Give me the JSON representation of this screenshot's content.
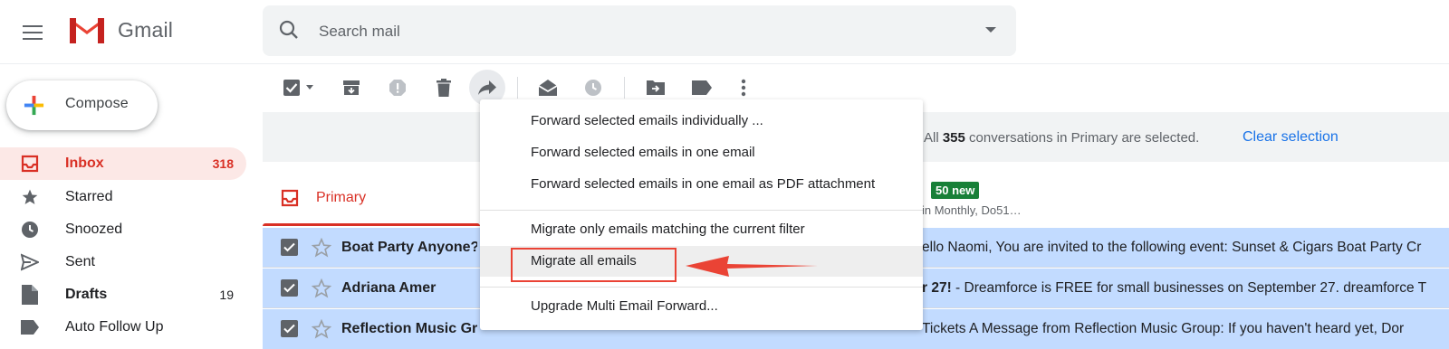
{
  "app": {
    "logo_text": "Gmail"
  },
  "search": {
    "placeholder": "Search mail"
  },
  "compose": {
    "label": "Compose"
  },
  "sidebar": {
    "items": [
      {
        "label": "Inbox",
        "count": "318",
        "icon": "inbox-icon",
        "active": true
      },
      {
        "label": "Starred",
        "count": "",
        "icon": "star-icon"
      },
      {
        "label": "Snoozed",
        "count": "",
        "icon": "clock-icon"
      },
      {
        "label": "Sent",
        "count": "",
        "icon": "send-icon"
      },
      {
        "label": "Drafts",
        "count": "19",
        "icon": "draft-icon"
      },
      {
        "label": "Auto Follow Up",
        "count": "",
        "icon": "label-icon"
      }
    ]
  },
  "toolbar": {
    "icons": [
      "select-all-checkbox",
      "archive-icon",
      "report-spam-icon",
      "delete-icon",
      "forward-icon",
      "mark-read-icon",
      "snooze-icon",
      "move-to-icon",
      "label-icon",
      "more-icon"
    ]
  },
  "banner": {
    "prefix": "All",
    "count": "355",
    "suffix": "conversations in Primary are selected.",
    "clear_label": "Clear selection"
  },
  "tabs": {
    "primary_label": "Primary",
    "new_badge": "50 new",
    "sub_text": "in Monthly, Do51…"
  },
  "emails": [
    {
      "sender": "Boat Party Anyone?",
      "subject": "",
      "snippet": "ello Naomi, You are invited to the following event: Sunset & Cigars Boat Party Cr"
    },
    {
      "sender": "Adriana Amer",
      "subject": "r 27!",
      "snippet": " - Dreamforce is FREE for small businesses on September 27. dreamforce T"
    },
    {
      "sender": "Reflection Music Gr",
      "subject": "",
      "snippet": "Tickets A Message from Reflection Music Group: If you haven't heard yet, Dor"
    }
  ],
  "dropdown": {
    "items": [
      "Forward selected emails individually ...",
      "Forward selected emails in one email",
      "Forward selected emails in one email as PDF attachment",
      "Migrate only emails matching the current filter",
      "Migrate all emails",
      "Upgrade Multi Email Forward..."
    ],
    "highlighted_index": 4
  },
  "colors": {
    "accent_red": "#d93025",
    "link_blue": "#1a73e8",
    "selected_row": "#c2dbff",
    "badge_green": "#188038",
    "annotation_red": "#ea4335"
  }
}
